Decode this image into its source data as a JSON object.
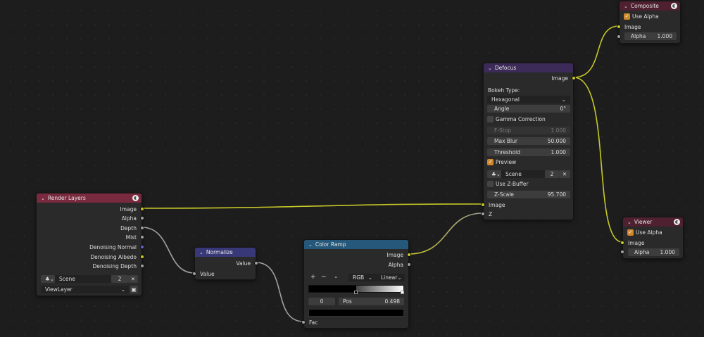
{
  "render_layers": {
    "title": "Render Layers",
    "outputs": [
      "Image",
      "Alpha",
      "Depth",
      "Mist",
      "Denoising Normal",
      "Denoising Albedo",
      "Denoising Depth"
    ],
    "scene": "Scene",
    "scene_users": "2",
    "view_layer": "ViewLayer",
    "header_color": "#7a2a3f"
  },
  "normalize": {
    "title": "Normalize",
    "output": "Value",
    "input": "Value",
    "header_color": "#383878"
  },
  "color_ramp": {
    "title": "Color Ramp",
    "outputs": [
      "Image",
      "Alpha"
    ],
    "add": "+",
    "remove": "−",
    "menu": "⌄",
    "color_mode": "RGB",
    "interpolation": "Linear",
    "stop_index": "0",
    "pos_label": "Pos",
    "pos_value": "0.498",
    "input": "Fac",
    "header_color": "#25587a"
  },
  "defocus": {
    "title": "Defocus",
    "output": "Image",
    "bokeh_label": "Bokeh Type:",
    "bokeh_value": "Hexagonal",
    "angle_label": "Angle",
    "angle_value": "0°",
    "gamma_label": "Gamma Correction",
    "fstop_label": "F-Stop",
    "fstop_value": "1.000",
    "maxblur_label": "Max Blur",
    "maxblur_value": "50.000",
    "threshold_label": "Threshold",
    "threshold_value": "1.000",
    "preview_label": "Preview",
    "scene": "Scene",
    "scene_users": "2",
    "zbuffer_label": "Use Z-Buffer",
    "zscale_label": "Z-Scale",
    "zscale_value": "95.700",
    "inputs": [
      "Image",
      "Z"
    ],
    "header_color": "#3c2a58"
  },
  "composite": {
    "title": "Composite",
    "use_alpha": "Use Alpha",
    "input": "Image",
    "alpha_label": "Alpha",
    "alpha_value": "1.000",
    "header_color": "#4e2030"
  },
  "viewer": {
    "title": "Viewer",
    "use_alpha": "Use Alpha",
    "input": "Image",
    "alpha_label": "Alpha",
    "alpha_value": "1.000",
    "header_color": "#4e2030"
  }
}
